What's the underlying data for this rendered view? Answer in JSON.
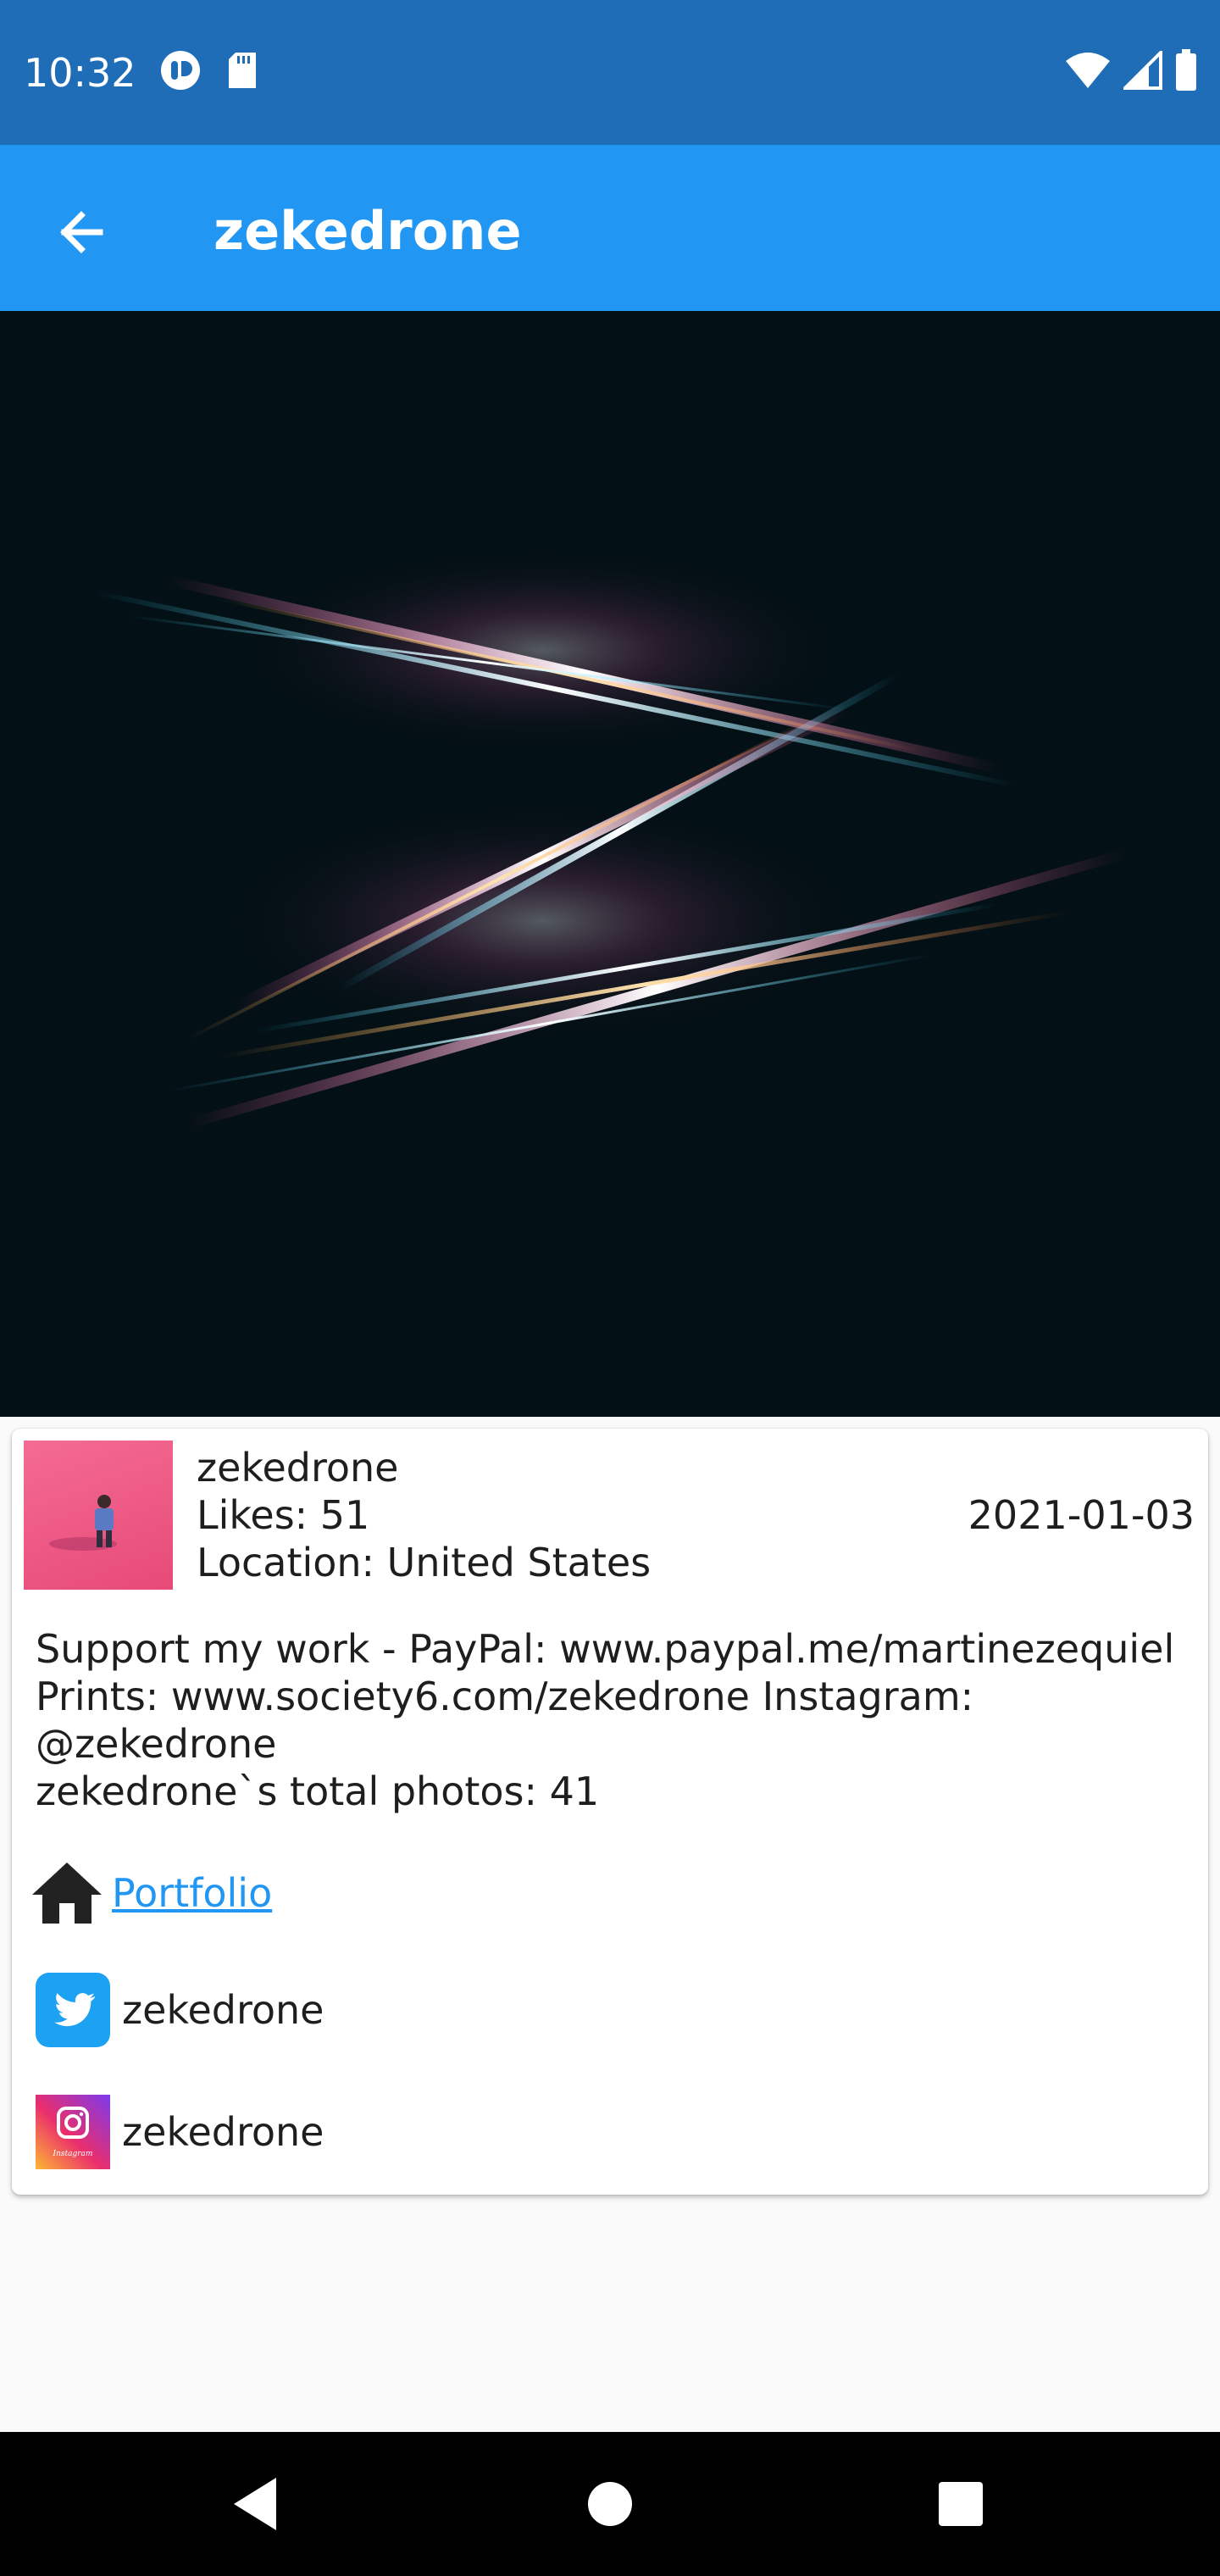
{
  "status_bar": {
    "time": "10:32",
    "left_icons": [
      "app-notification-icon",
      "sd-card-icon"
    ],
    "right_icons": [
      "wifi-icon",
      "cellular-signal-icon",
      "battery-icon"
    ]
  },
  "app_bar": {
    "back_icon": "arrow-back-icon",
    "title": "zekedrone"
  },
  "user_card": {
    "username": "zekedrone",
    "likes": "Likes: 51",
    "location": "Location: United States",
    "date": "2021-01-03",
    "bio_line1": "Support my work - PayPal: www.paypal.me/martinezequiel",
    "bio_line2": "Prints: www.society6.com/zekedrone  Instagram: @zekedrone",
    "total_photos": "zekedrone`s total photos: 41",
    "portfolio_label": "Portfolio",
    "twitter_handle": "zekedrone",
    "instagram_handle": "zekedrone",
    "instagram_badge": "Instagram"
  },
  "nav_bar": {
    "back": "nav-back-icon",
    "home": "nav-home-icon",
    "recents": "nav-recents-icon"
  },
  "colors": {
    "status_bar": "#1f6db6",
    "app_bar": "#2196f3",
    "hero_background": "#031015",
    "link": "#2196f3"
  }
}
